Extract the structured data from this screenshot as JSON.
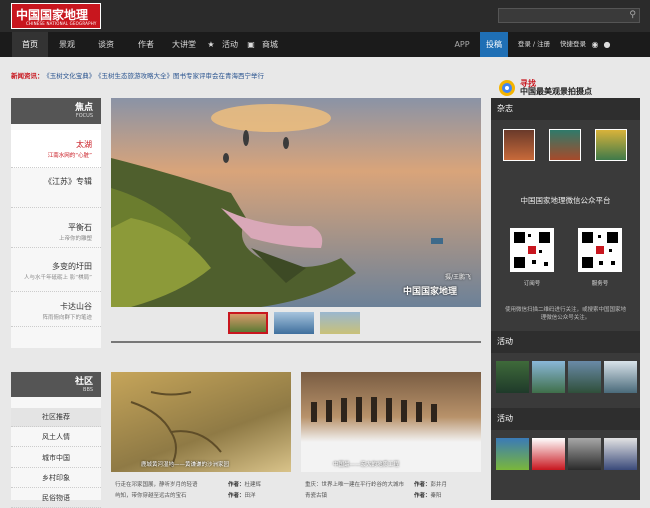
{
  "header": {
    "logo_cn": "中国国家地理",
    "logo_en": "CHINESE NATIONAL GEOGRAPHY",
    "search_placeholder": ""
  },
  "nav": {
    "items": [
      "首页",
      "景观",
      "谈资",
      "作者",
      "大讲堂",
      "活动",
      "商城"
    ],
    "app": "APP",
    "submit": "投稿",
    "login": "登录 / 注册",
    "quick_login": "快捷登录"
  },
  "news": {
    "label": "新闻资讯：",
    "items": [
      "《玉树文化宝典》",
      "《玉树生态旅游攻略大全》图书专家评审会在青海西宁举行"
    ]
  },
  "focus": {
    "title": "焦点",
    "title_en": "FOCUS",
    "items": [
      {
        "title": "太湖",
        "sub": "江南水网的“心脏”"
      },
      {
        "title": "《江苏》专辑",
        "sub": ""
      },
      {
        "title": "平衡石",
        "sub": "上帝你的雕塑"
      },
      {
        "title": "多变的圩田",
        "sub": "人与水千年砥砺上 影“棋局”"
      },
      {
        "title": "卡达山谷",
        "sub": "阵雨俯向群下的笔迹"
      }
    ]
  },
  "main": {
    "credit": "摄/王鹏飞"
  },
  "cards": [
    {
      "caption": "鹿城黄河湿地——黄谦谦的沙洲家园",
      "desc1": "行走在邛家国展，静听岁月的轻语",
      "desc2": "屿知，带你穿越至远古的宝石",
      "author_lbl": "作者：",
      "author1": "杜建辉",
      "author2": "田洋"
    },
    {
      "caption": "中国最——宏大的地质工程",
      "desc1": "重庆：世界上唯一建在平行岭谷的大城市",
      "desc2": "青瓷古镇",
      "author_lbl": "作者：",
      "author1": "彭井月",
      "author2": "秦阳"
    }
  ],
  "community": {
    "title": "社区",
    "title_en": "BBS",
    "items": [
      "社区推荐",
      "风土人情",
      "城市中国",
      "乡村印象",
      "民俗物语"
    ]
  },
  "right": {
    "banner_t1": "寻找",
    "banner_t2": "中国最美观景拍摄点",
    "magazine": "杂志",
    "wechat": "中国国家地理微信公众平台",
    "qr1": "订阅号",
    "qr2": "服务号",
    "wechat_tip": "使用微信扫描二维码进行关注，或搜索中国国家地理微信公众号关注。",
    "activity": "活动"
  }
}
